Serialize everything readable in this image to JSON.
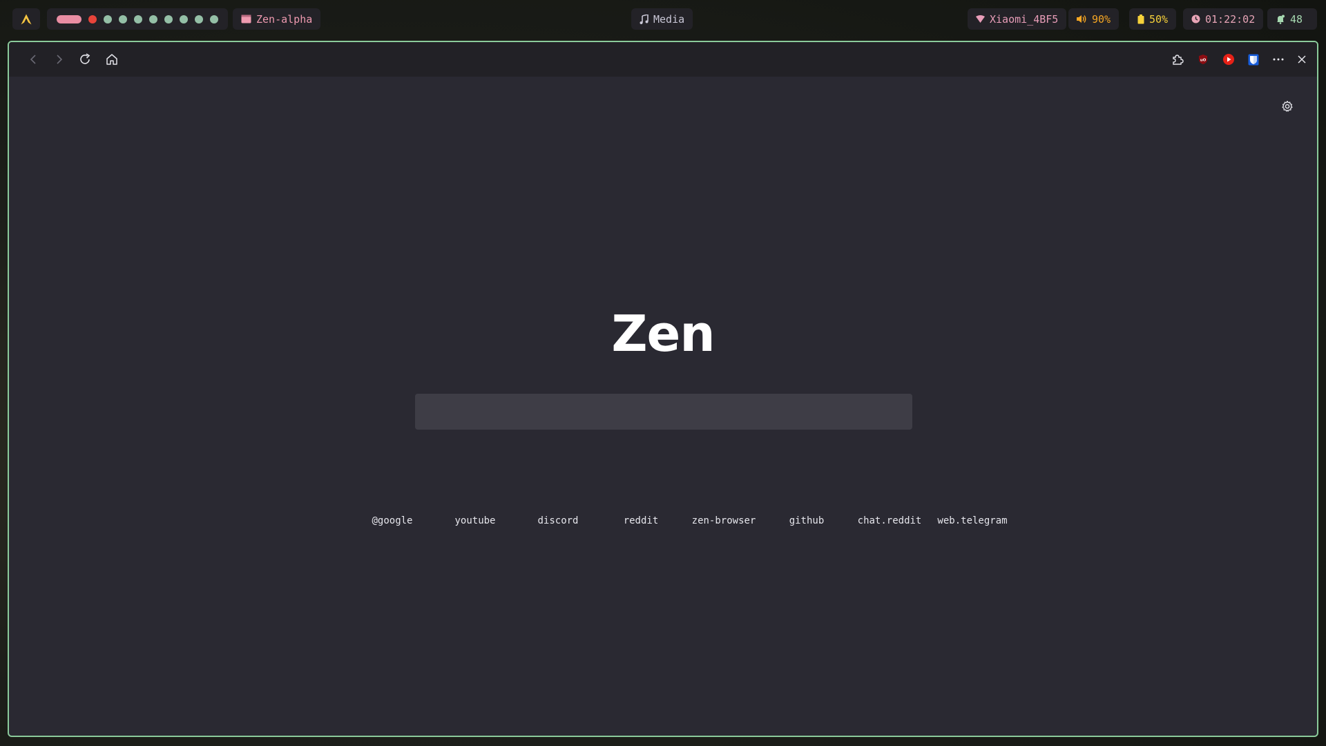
{
  "topbar": {
    "workspaces_count": 9,
    "active_window_title": "Zen-alpha",
    "media_label": "Media",
    "wifi_name": "Xiaomi_4BF5",
    "volume": "90%",
    "battery": "50%",
    "clock": "01:22:02",
    "notifications": "48",
    "colors": {
      "workspace_active_pill": "#e98da3",
      "workspace_urgent": "#e8443a",
      "workspace_dot": "#94bfa6",
      "window_border": "#8bcb9b"
    }
  },
  "browser": {
    "nav_icons": [
      "back-icon",
      "forward-icon",
      "reload-icon",
      "home-icon"
    ],
    "toolbar_icons": [
      "extensions-icon",
      "ublock-icon",
      "youtube-icon",
      "bitwarden-icon",
      "more-icon",
      "close-icon"
    ],
    "newtab": {
      "brand": "Zen",
      "search_placeholder": "",
      "shortcuts": [
        "@google",
        "youtube",
        "discord",
        "reddit",
        "zen-browser",
        "github",
        "chat.reddit",
        "web.telegram"
      ]
    }
  }
}
